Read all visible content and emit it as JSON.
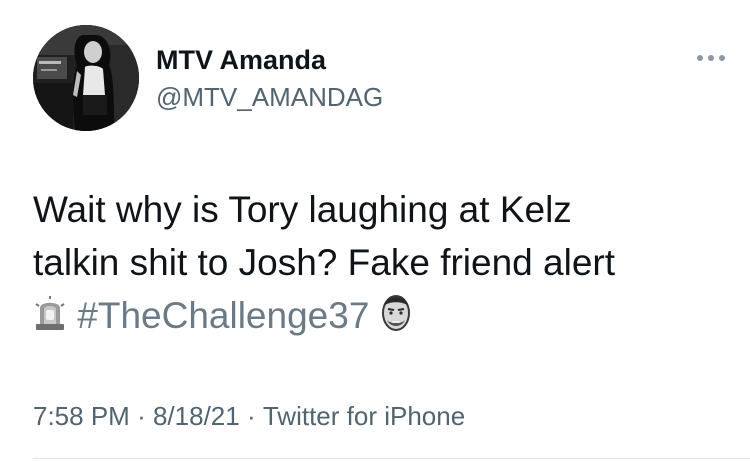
{
  "user": {
    "display_name": "MTV Amanda",
    "handle": "@MTV_AMANDAG",
    "avatar_icon": "profile-photo"
  },
  "more_icon": "more-horizontal-icon",
  "tweet": {
    "line1": "Wait why is Tory laughing at Kelz",
    "line2": "talkin shit to Josh? Fake friend alert",
    "emoji_siren": "police-siren-emoji",
    "hashtag": "#TheChallenge37",
    "emoji_face": "challenge-hashflag-emoji"
  },
  "meta": {
    "time": "7:58 PM",
    "date": "8/18/21",
    "separator": "·",
    "source": "Twitter for iPhone"
  },
  "colors": {
    "text": "#0f1419",
    "secondary": "#536471",
    "hashtag": "#6b7a86"
  }
}
